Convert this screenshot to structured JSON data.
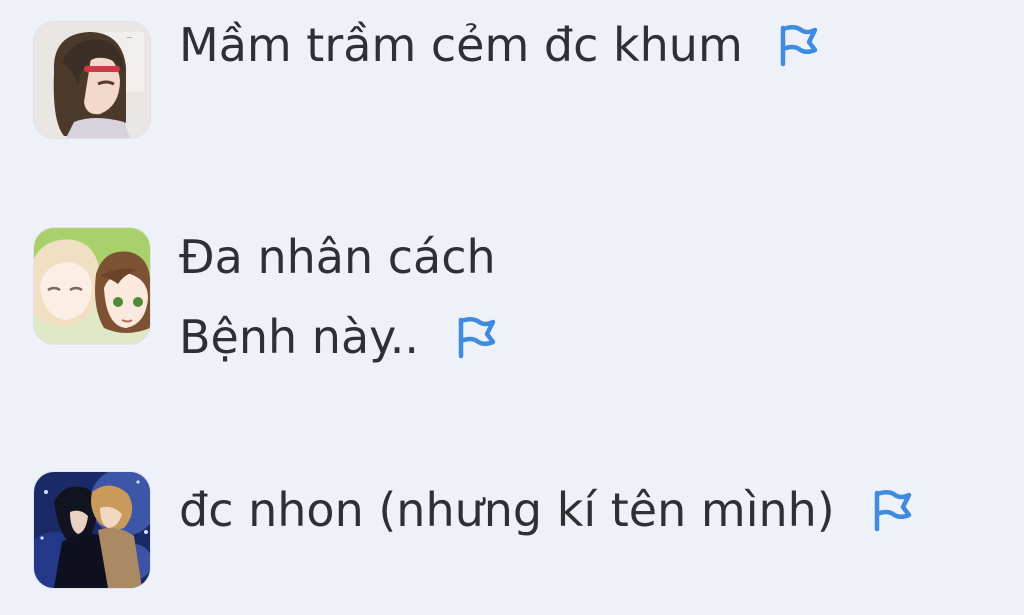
{
  "comments": [
    {
      "lines": [
        "Mầm trầm cẻm đc khum"
      ],
      "avatar_icon": "anime-girl-avatar-icon",
      "flag_icon": "report-flag-icon"
    },
    {
      "lines": [
        "Đa nhân cách",
        "Bệnh này.."
      ],
      "avatar_icon": "anime-couple-avatar-icon",
      "flag_icon": "report-flag-icon"
    },
    {
      "lines": [
        "đc nhon (nhưng kí tên mình)"
      ],
      "avatar_icon": "anime-night-avatar-icon",
      "flag_icon": "report-flag-icon"
    }
  ],
  "colors": {
    "background": "#eef2f8",
    "text": "#2f3033",
    "flag": "#3f8be0"
  }
}
